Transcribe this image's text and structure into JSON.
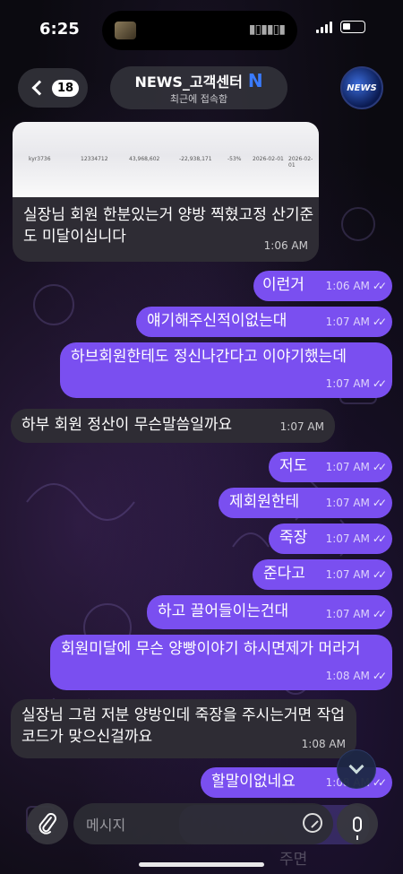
{
  "status_bar": {
    "time": "6:25"
  },
  "header": {
    "back_count": "18",
    "title": "NEWS_고객센터",
    "verified_mark": "N",
    "subtitle": "최근에 접속함",
    "avatar_label": "NEWS"
  },
  "image_preview": {
    "cells": [
      "kyr3736",
      "12334712",
      "43,968,602",
      "-22,938,171",
      "-53%",
      "2026-02-01",
      "2026-02-01"
    ]
  },
  "messages": [
    {
      "dir": "in",
      "text": "실장님 회원 한분있는거 양방 찍혔고정 산기준도 미달이십니다",
      "time": "1:06 AM"
    },
    {
      "dir": "out",
      "text": "이런거",
      "time": "1:06 AM"
    },
    {
      "dir": "out",
      "text": "얘기해주신적이없는대",
      "time": "1:07 AM"
    },
    {
      "dir": "out",
      "text": "하브회원한테도 정신나간다고 이야기했는데",
      "time": "1:07 AM"
    },
    {
      "dir": "in",
      "text": "하부 회원 정산이 무슨말씀일까요",
      "time": "1:07 AM"
    },
    {
      "dir": "out",
      "text": "저도",
      "time": "1:07 AM"
    },
    {
      "dir": "out",
      "text": "제회원한테",
      "time": "1:07 AM"
    },
    {
      "dir": "out",
      "text": "죽장",
      "time": "1:07 AM"
    },
    {
      "dir": "out",
      "text": "준다고",
      "time": "1:07 AM"
    },
    {
      "dir": "out",
      "text": "하고 끌어들이는건대",
      "time": "1:07 AM"
    },
    {
      "dir": "out",
      "text": "회원미달에 무슨 양빵이야기 하시면제가 머라거",
      "time": "1:08 AM"
    },
    {
      "dir": "in",
      "text": "실장님 그럼 저분 양방인데 죽장을 주시는거면 작업코드가 맞으신걸까요",
      "time": "1:08 AM"
    },
    {
      "dir": "out",
      "text": "할말이없네요",
      "time": "1:08 AM"
    }
  ],
  "composer": {
    "placeholder": "메시지"
  },
  "ghost_text": {
    "bottom": "주면"
  },
  "colors": {
    "outgoing": "#7a4ff0",
    "incoming": "#2e2c34",
    "verified": "#3a7bff"
  },
  "icons": {
    "back": "chevron-left-icon",
    "attach": "paperclip-icon",
    "sticker": "sticker-icon",
    "mic": "microphone-icon",
    "scroll": "chevron-down-icon",
    "read": "double-check-icon"
  }
}
